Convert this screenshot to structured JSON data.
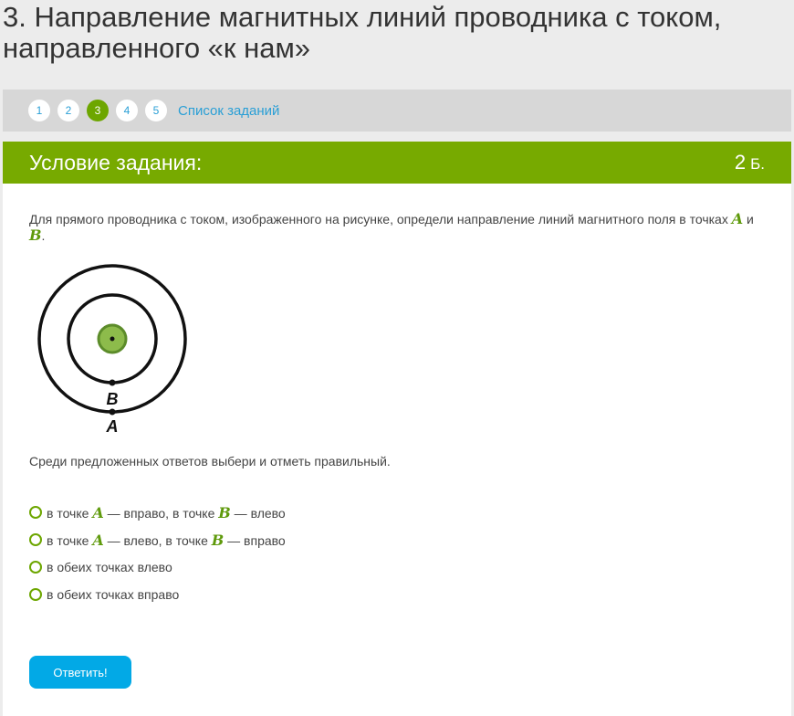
{
  "title": "3. Направление магнитных линий проводника с током, направленного «к нам»",
  "nav": {
    "numbers": [
      "1",
      "2",
      "3",
      "4",
      "5"
    ],
    "current": 2,
    "tasks_link": "Список заданий"
  },
  "card": {
    "header_title": "Условие задания:",
    "points_value": "2",
    "points_unit": "Б."
  },
  "problem": {
    "text_before": "Для прямого проводника с током, изображенного на рисунке, определи направление линий магнитного поля в точках ",
    "var_a": "A",
    "conj": " и ",
    "var_b": "B",
    "text_after": "."
  },
  "diagram": {
    "label_b": "B",
    "label_a": "A",
    "colors": {
      "conductor_fill": "#8dbb4b",
      "conductor_stroke": "#5c8c2a",
      "lines": "#111111"
    }
  },
  "instruction": "Среди предложенных ответов выбери и отметь правильный.",
  "options": [
    {
      "p1": "в точке ",
      "v1": "A",
      "p2": " — вправо, в точке ",
      "v2": "B",
      "p3": " — влево"
    },
    {
      "p1": "в точке ",
      "v1": "A",
      "p2": " — влево, в точке ",
      "v2": "B",
      "p3": " — вправо"
    },
    {
      "text": "в обеих точках влево"
    },
    {
      "text": "в обеих точках вправо"
    }
  ],
  "submit_label": "Ответить!",
  "colors": {
    "accent_green": "#77aa00",
    "link_blue": "#2a9fd6",
    "button_blue": "#02a9e6"
  }
}
